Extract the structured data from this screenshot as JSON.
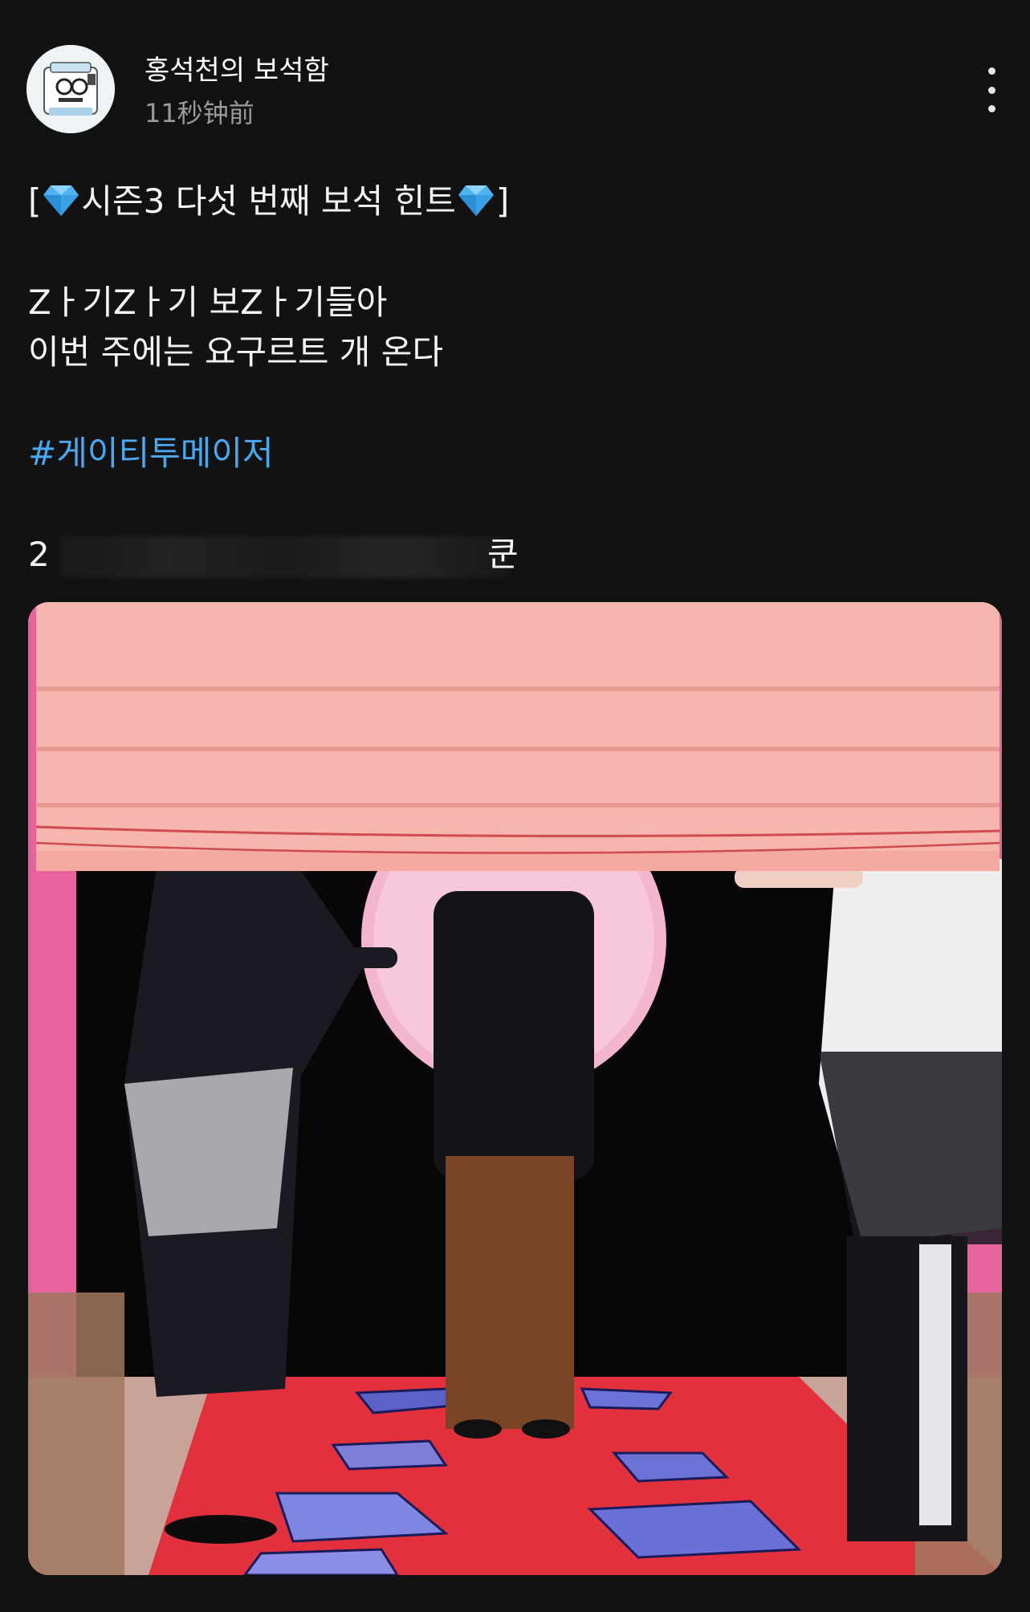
{
  "post": {
    "author": {
      "name": "홍석천의 보석함",
      "avatar_icon": "avatar-icon"
    },
    "timestamp": "11秒钟前",
    "menu_icon": "more-vertical-icon",
    "text": {
      "title_prefix": "[",
      "title_main": "시즌3 다섯 번째 보석 힌트",
      "title_suffix": "]",
      "line1": "Zㅏ기Zㅏ기 보Zㅏ기들아",
      "line2": "이번 주에는 요구르트 개 온다",
      "hashtag": "#게이티투메이저",
      "partial_start": "2",
      "partial_end": "쿤"
    },
    "image": {
      "icon": "post-photo"
    },
    "colors": {
      "hashtag": "#4aa8f0",
      "background": "#121212",
      "secondary_text": "#9a9a9a"
    }
  }
}
